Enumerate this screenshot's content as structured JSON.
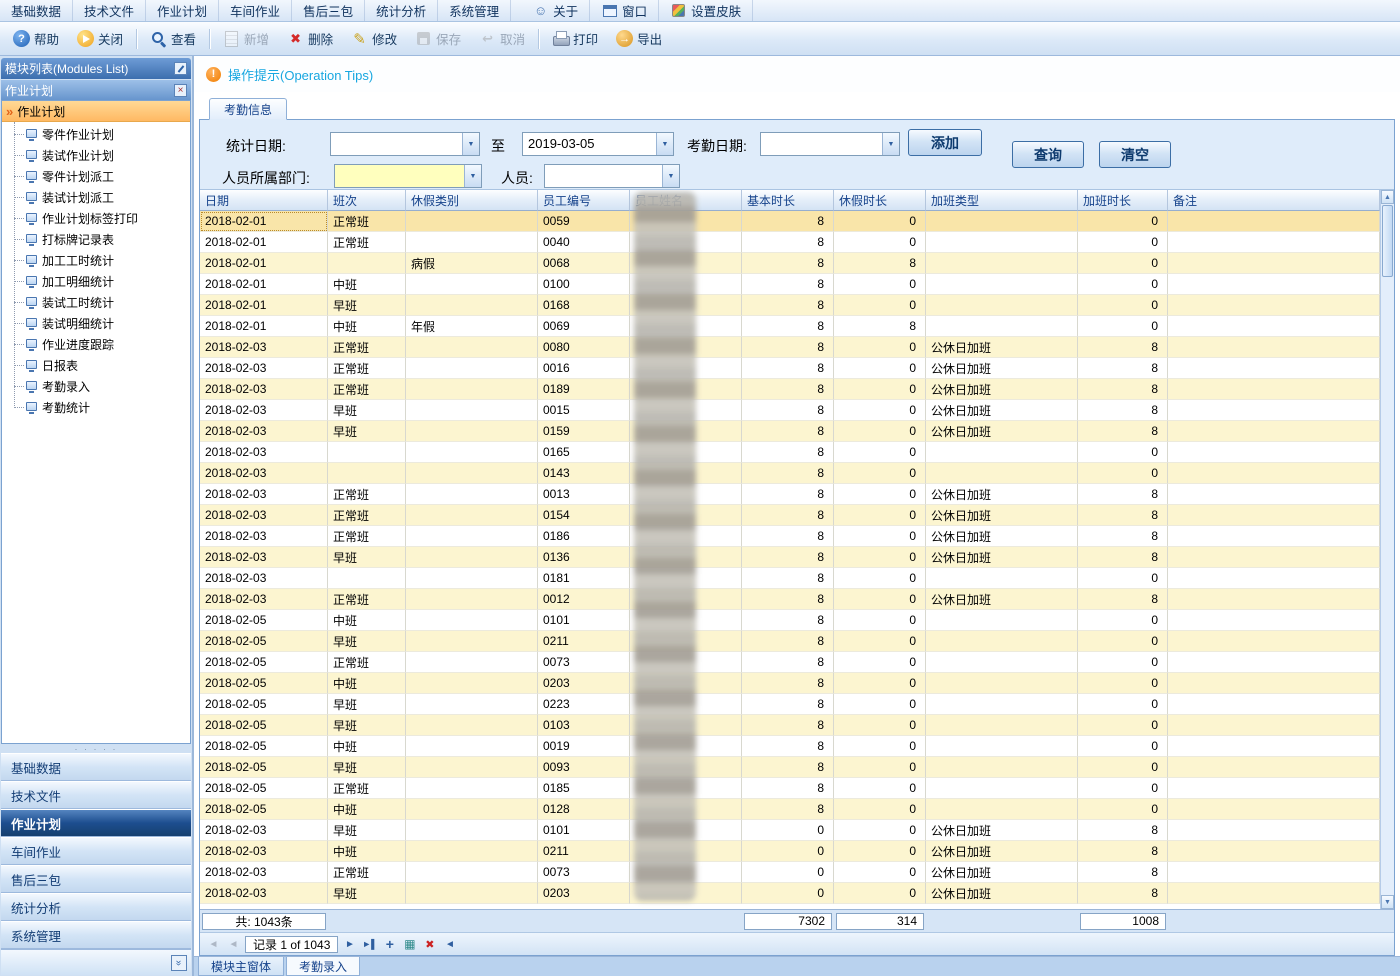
{
  "menubar": {
    "items": [
      "基础数据",
      "技术文件",
      "作业计划",
      "车间作业",
      "售后三包",
      "统计分析",
      "系统管理"
    ],
    "icon_items": [
      {
        "label": "关于",
        "icon": "about-icon"
      },
      {
        "label": "窗口",
        "icon": "window-icon"
      },
      {
        "label": "设置皮肤",
        "icon": "skin-icon"
      }
    ]
  },
  "toolbar": {
    "buttons": [
      {
        "name": "help",
        "label": "帮助",
        "icon": "help-icon",
        "enabled": true,
        "sep_after": false
      },
      {
        "name": "close",
        "label": "关闭",
        "icon": "exit-icon",
        "enabled": true,
        "sep_after": true
      },
      {
        "name": "view",
        "label": "查看",
        "icon": "view-icon",
        "enabled": true,
        "sep_after": true
      },
      {
        "name": "add",
        "label": "新增",
        "icon": "new-icon",
        "enabled": false,
        "sep_after": false
      },
      {
        "name": "delete",
        "label": "删除",
        "icon": "delete-icon",
        "enabled": true,
        "sep_after": false
      },
      {
        "name": "modify",
        "label": "修改",
        "icon": "edit-icon",
        "enabled": true,
        "sep_after": false
      },
      {
        "name": "save",
        "label": "保存",
        "icon": "save-icon",
        "enabled": false,
        "sep_after": false
      },
      {
        "name": "cancel",
        "label": "取消",
        "icon": "cancel-icon",
        "enabled": false,
        "sep_after": true
      },
      {
        "name": "print",
        "label": "打印",
        "icon": "print-icon",
        "enabled": true,
        "sep_after": false
      },
      {
        "name": "export",
        "label": "导出",
        "icon": "export-icon",
        "enabled": true,
        "sep_after": false
      }
    ]
  },
  "sidebar": {
    "modules_title": "模块列表(Modules List)",
    "panel_title": "作业计划",
    "tree_group": "作业计划",
    "tree_items": [
      "零件作业计划",
      "装试作业计划",
      "零件计划派工",
      "装试计划派工",
      "作业计划标签打印",
      "打标牌记录表",
      "加工工时统计",
      "加工明细统计",
      "装试工时统计",
      "装试明细统计",
      "作业进度跟踪",
      "日报表",
      "考勤录入",
      "考勤统计"
    ],
    "nav_buttons": [
      "基础数据",
      "技术文件",
      "作业计划",
      "车间作业",
      "售后三包",
      "统计分析",
      "系统管理"
    ],
    "active_nav": "作业计划"
  },
  "main": {
    "tips": "操作提示(Operation Tips)",
    "tab": "考勤信息",
    "filters": {
      "stat_date_label": "统计日期:",
      "to_label": "至",
      "stat_date_from": "",
      "stat_date_to": "2019-03-05",
      "attend_date_label": "考勤日期:",
      "attend_date": "",
      "dept_label": "人员所属部门:",
      "dept_value": "",
      "person_label": "人员:",
      "person_value": "",
      "add_button": "添加",
      "query_button": "查询",
      "clear_button": "清空"
    },
    "table": {
      "columns": [
        "日期",
        "班次",
        "休假类别",
        "员工编号",
        "员工姓名",
        "基本时长",
        "休假时长",
        "加班类型",
        "加班时长",
        "备注"
      ],
      "rows": [
        [
          "2018-02-01",
          "正常班",
          "",
          "0059",
          "8",
          "0",
          "",
          "0",
          ""
        ],
        [
          "2018-02-01",
          "正常班",
          "",
          "0040",
          "8",
          "0",
          "",
          "0",
          ""
        ],
        [
          "2018-02-01",
          "",
          "病假",
          "0068",
          "8",
          "8",
          "",
          "0",
          ""
        ],
        [
          "2018-02-01",
          "中班",
          "",
          "0100",
          "8",
          "0",
          "",
          "0",
          ""
        ],
        [
          "2018-02-01",
          "早班",
          "",
          "0168",
          "8",
          "0",
          "",
          "0",
          ""
        ],
        [
          "2018-02-01",
          "中班",
          "年假",
          "0069",
          "8",
          "8",
          "",
          "0",
          ""
        ],
        [
          "2018-02-03",
          "正常班",
          "",
          "0080",
          "8",
          "0",
          "公休日加班",
          "8",
          ""
        ],
        [
          "2018-02-03",
          "正常班",
          "",
          "0016",
          "8",
          "0",
          "公休日加班",
          "8",
          ""
        ],
        [
          "2018-02-03",
          "正常班",
          "",
          "0189",
          "8",
          "0",
          "公休日加班",
          "8",
          ""
        ],
        [
          "2018-02-03",
          "早班",
          "",
          "0015",
          "8",
          "0",
          "公休日加班",
          "8",
          ""
        ],
        [
          "2018-02-03",
          "早班",
          "",
          "0159",
          "8",
          "0",
          "公休日加班",
          "8",
          ""
        ],
        [
          "2018-02-03",
          "",
          "",
          "0165",
          "8",
          "0",
          "",
          "0",
          ""
        ],
        [
          "2018-02-03",
          "",
          "",
          "0143",
          "8",
          "0",
          "",
          "0",
          ""
        ],
        [
          "2018-02-03",
          "正常班",
          "",
          "0013",
          "8",
          "0",
          "公休日加班",
          "8",
          ""
        ],
        [
          "2018-02-03",
          "正常班",
          "",
          "0154",
          "8",
          "0",
          "公休日加班",
          "8",
          ""
        ],
        [
          "2018-02-03",
          "正常班",
          "",
          "0186",
          "8",
          "0",
          "公休日加班",
          "8",
          ""
        ],
        [
          "2018-02-03",
          "早班",
          "",
          "0136",
          "8",
          "0",
          "公休日加班",
          "8",
          ""
        ],
        [
          "2018-02-03",
          "",
          "",
          "0181",
          "8",
          "0",
          "",
          "0",
          ""
        ],
        [
          "2018-02-03",
          "正常班",
          "",
          "0012",
          "8",
          "0",
          "公休日加班",
          "8",
          ""
        ],
        [
          "2018-02-05",
          "中班",
          "",
          "0101",
          "8",
          "0",
          "",
          "0",
          ""
        ],
        [
          "2018-02-05",
          "早班",
          "",
          "0211",
          "8",
          "0",
          "",
          "0",
          ""
        ],
        [
          "2018-02-05",
          "正常班",
          "",
          "0073",
          "8",
          "0",
          "",
          "0",
          ""
        ],
        [
          "2018-02-05",
          "中班",
          "",
          "0203",
          "8",
          "0",
          "",
          "0",
          ""
        ],
        [
          "2018-02-05",
          "早班",
          "",
          "0223",
          "8",
          "0",
          "",
          "0",
          ""
        ],
        [
          "2018-02-05",
          "早班",
          "",
          "0103",
          "8",
          "0",
          "",
          "0",
          ""
        ],
        [
          "2018-02-05",
          "中班",
          "",
          "0019",
          "8",
          "0",
          "",
          "0",
          ""
        ],
        [
          "2018-02-05",
          "早班",
          "",
          "0093",
          "8",
          "0",
          "",
          "0",
          ""
        ],
        [
          "2018-02-05",
          "正常班",
          "",
          "0185",
          "8",
          "0",
          "",
          "0",
          ""
        ],
        [
          "2018-02-05",
          "中班",
          "",
          "0128",
          "8",
          "0",
          "",
          "0",
          ""
        ],
        [
          "2018-02-03",
          "早班",
          "",
          "0101",
          "0",
          "0",
          "公休日加班",
          "8",
          ""
        ],
        [
          "2018-02-03",
          "中班",
          "",
          "0211",
          "0",
          "0",
          "公休日加班",
          "8",
          ""
        ],
        [
          "2018-02-03",
          "正常班",
          "",
          "0073",
          "0",
          "0",
          "公休日加班",
          "8",
          ""
        ],
        [
          "2018-02-03",
          "早班",
          "",
          "0203",
          "0",
          "0",
          "公休日加班",
          "8",
          ""
        ]
      ],
      "count_label": "共: 1043条",
      "totals": {
        "basic_hours": "7302",
        "leave_hours": "314",
        "overtime_hours": "1008"
      }
    },
    "record_nav": {
      "label": "记录 1 of 1043"
    },
    "bottom_tabs": [
      "模块主窗体",
      "考勤录入"
    ]
  }
}
